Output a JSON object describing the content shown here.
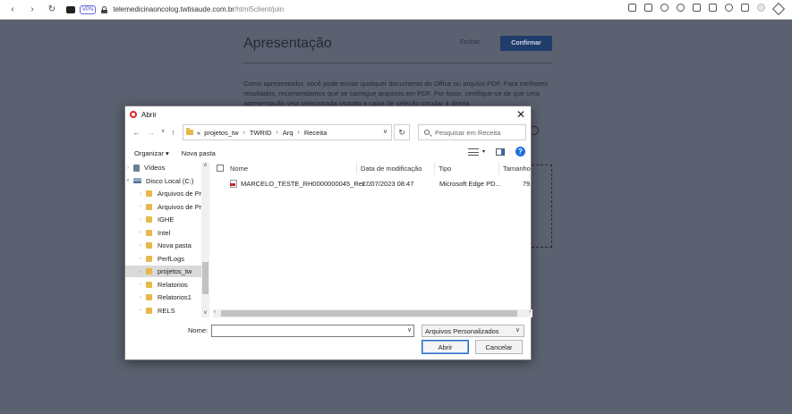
{
  "browser": {
    "vpn_label": "VPN",
    "url_host": "telemedicinaoncolog.twtisaude.com.br",
    "url_path": "/html5client/join"
  },
  "background": {
    "title": "Apresentação",
    "close_label": "Fechar",
    "confirm_label": "Confirmar",
    "description": "Como apresentador, você pode enviar qualquer documento do Office ou arquivo PDF. Para melhores resultados, recomendamos que se carregue arquivos em PDF. Por favor, certifique-se de que uma apresentação seja selecionada usando a caixa de seleção circular à direita."
  },
  "dialog": {
    "title": "Abrir",
    "breadcrumb_prefix": "«",
    "breadcrumb": [
      "projetos_tw",
      "TWRID",
      "Arq",
      "Receita"
    ],
    "search_placeholder": "Pesquisar em Receita",
    "toolbar": {
      "organize": "Organizar",
      "new_folder": "Nova pasta"
    },
    "nav_items": [
      {
        "label": "Vídeos",
        "icon": "video-icon"
      },
      {
        "label": "Disco Local (C:)",
        "icon": "disk-icon"
      },
      {
        "label": "Arquivos de Pr",
        "icon": "folder-icon"
      },
      {
        "label": "Arquivos de Pr",
        "icon": "folder-icon"
      },
      {
        "label": "IGHE",
        "icon": "folder-icon"
      },
      {
        "label": "Intel",
        "icon": "folder-icon"
      },
      {
        "label": "Nova pasta",
        "icon": "folder-icon"
      },
      {
        "label": "PerfLogs",
        "icon": "folder-icon"
      },
      {
        "label": "projetos_tw",
        "icon": "folder-icon",
        "selected": true
      },
      {
        "label": "Relatorios",
        "icon": "folder-icon"
      },
      {
        "label": "Relatorios1",
        "icon": "folder-icon"
      },
      {
        "label": "RELS",
        "icon": "folder-icon"
      }
    ],
    "columns": {
      "name": "Nome",
      "date": "Data de modificação",
      "type": "Tipo",
      "size": "Tamanho"
    },
    "files": [
      {
        "name": "MARCELO_TESTE_RH0000000045_Rec...",
        "date": "17/07/2023 08:47",
        "type": "Microsoft Edge PD...",
        "size": "79"
      }
    ],
    "filename_label": "Nome:",
    "filename_value": "",
    "file_type": "Arquivos Personalizados",
    "open_button": "Abrir",
    "cancel_button": "Cancelar"
  }
}
